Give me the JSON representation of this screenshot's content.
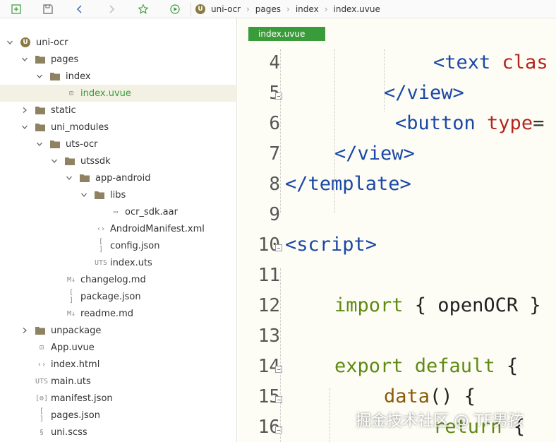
{
  "breadcrumb": [
    "uni-ocr",
    "pages",
    "index",
    "index.uvue"
  ],
  "toolbar": {
    "buttons": [
      "new-file-icon",
      "save-icon",
      "back-icon",
      "forward-icon",
      "star-icon",
      "run-icon"
    ]
  },
  "tree": [
    {
      "label": "uni-ocr",
      "depth": 0,
      "kind": "project",
      "expanded": true
    },
    {
      "label": "pages",
      "depth": 1,
      "kind": "folder",
      "expanded": true
    },
    {
      "label": "index",
      "depth": 2,
      "kind": "folder",
      "expanded": true
    },
    {
      "label": "index.uvue",
      "depth": 3,
      "kind": "uvue",
      "selected": true
    },
    {
      "label": "static",
      "depth": 1,
      "kind": "folder",
      "expanded": false
    },
    {
      "label": "uni_modules",
      "depth": 1,
      "kind": "folder",
      "expanded": true
    },
    {
      "label": "uts-ocr",
      "depth": 2,
      "kind": "folder",
      "expanded": true
    },
    {
      "label": "utssdk",
      "depth": 3,
      "kind": "folder",
      "expanded": true
    },
    {
      "label": "app-android",
      "depth": 4,
      "kind": "folder",
      "expanded": true
    },
    {
      "label": "libs",
      "depth": 5,
      "kind": "folder",
      "expanded": true
    },
    {
      "label": "ocr_sdk.aar",
      "depth": 6,
      "kind": "file"
    },
    {
      "label": "AndroidManifest.xml",
      "depth": 5,
      "kind": "xml"
    },
    {
      "label": "config.json",
      "depth": 5,
      "kind": "json"
    },
    {
      "label": "index.uts",
      "depth": 5,
      "kind": "uts"
    },
    {
      "label": "changelog.md",
      "depth": 3,
      "kind": "md"
    },
    {
      "label": "package.json",
      "depth": 3,
      "kind": "json"
    },
    {
      "label": "readme.md",
      "depth": 3,
      "kind": "md"
    },
    {
      "label": "unpackage",
      "depth": 1,
      "kind": "folder",
      "expanded": false
    },
    {
      "label": "App.uvue",
      "depth": 1,
      "kind": "uvue"
    },
    {
      "label": "index.html",
      "depth": 1,
      "kind": "xml"
    },
    {
      "label": "main.uts",
      "depth": 1,
      "kind": "uts"
    },
    {
      "label": "manifest.json",
      "depth": 1,
      "kind": "manifest"
    },
    {
      "label": "pages.json",
      "depth": 1,
      "kind": "json"
    },
    {
      "label": "uni.scss",
      "depth": 1,
      "kind": "scss"
    }
  ],
  "editor": {
    "tab_label": "index.uvue",
    "lines": [
      {
        "n": "4",
        "fold": false,
        "tokens": [
          [
            "tag",
            "<text "
          ],
          [
            "attr",
            "clas"
          ]
        ]
      },
      {
        "n": "5",
        "fold": true,
        "tokens": [
          [
            "tag",
            "</view>"
          ]
        ]
      },
      {
        "n": "6",
        "fold": false,
        "tokens": [
          [
            "tag",
            "<button "
          ],
          [
            "attr",
            "type"
          ],
          [
            "punct",
            "="
          ]
        ]
      },
      {
        "n": "7",
        "fold": false,
        "tokens": [
          [
            "tag",
            "</view>"
          ]
        ]
      },
      {
        "n": "8",
        "fold": false,
        "tokens": [
          [
            "tag",
            "</template>"
          ]
        ]
      },
      {
        "n": "9",
        "fold": false,
        "tokens": []
      },
      {
        "n": "10",
        "fold": true,
        "tokens": [
          [
            "tag",
            "<script>"
          ]
        ]
      },
      {
        "n": "11",
        "fold": false,
        "tokens": []
      },
      {
        "n": "12",
        "fold": false,
        "tokens": [
          [
            "kw",
            "import "
          ],
          [
            "ident",
            "{ openOCR }"
          ]
        ]
      },
      {
        "n": "13",
        "fold": false,
        "tokens": []
      },
      {
        "n": "14",
        "fold": true,
        "tokens": [
          [
            "kw",
            "export default "
          ],
          [
            "ident",
            "{"
          ]
        ]
      },
      {
        "n": "15",
        "fold": true,
        "tokens": [
          [
            "fn",
            "data"
          ],
          [
            "ident",
            "() {"
          ]
        ]
      },
      {
        "n": "16",
        "fold": true,
        "tokens": [
          [
            "kw",
            "return "
          ],
          [
            "ident",
            "{"
          ]
        ]
      }
    ]
  },
  "watermark": "掘金技术社区 @ TF男孩",
  "colors": {
    "accent": "#3a9b3a",
    "selected_row": "#f3f1e4",
    "editor_bg": "#fdfdf5"
  }
}
